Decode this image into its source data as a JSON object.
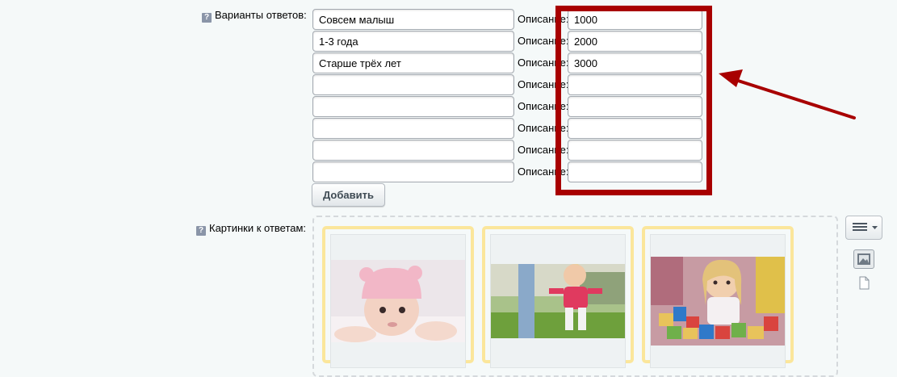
{
  "labels": {
    "answers": "Варианты ответов:",
    "images": "Картинки к ответам:",
    "description": "Описание:",
    "help": "?"
  },
  "answers": [
    {
      "value": "Совсем малыш",
      "description": "1000"
    },
    {
      "value": "1-3 года",
      "description": "2000"
    },
    {
      "value": "Старше трёх лет",
      "description": "3000"
    },
    {
      "value": "",
      "description": ""
    },
    {
      "value": "",
      "description": ""
    },
    {
      "value": "",
      "description": ""
    },
    {
      "value": "",
      "description": ""
    },
    {
      "value": "",
      "description": ""
    }
  ],
  "add_button": "Добавить",
  "images": [
    {
      "alt": "baby-in-pink-hat"
    },
    {
      "alt": "toddler-walking-on-grass"
    },
    {
      "alt": "girl-with-toy-blocks"
    }
  ],
  "colors": {
    "highlight": "#a80000",
    "card_border": "#fbe69b",
    "background": "#f5f9f9"
  },
  "icons": [
    "help-icon",
    "hamburger-menu-icon",
    "image-icon",
    "file-icon",
    "arrow-annotation"
  ]
}
